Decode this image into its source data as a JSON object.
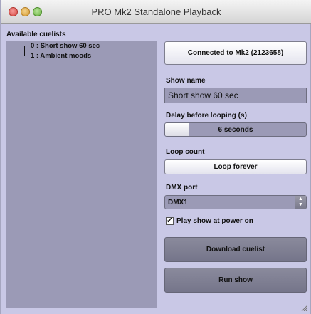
{
  "window": {
    "title": "PRO Mk2 Standalone Playback"
  },
  "cuelists": {
    "label": "Available cuelists",
    "items": [
      {
        "label": "0 : Short show 60 sec"
      },
      {
        "label": "1 : Ambient moods"
      }
    ]
  },
  "connection": {
    "button_label": "Connected to Mk2 (2123658)"
  },
  "show_name": {
    "label": "Show name",
    "value": "Short show 60 sec"
  },
  "delay": {
    "label": "Delay before looping (s)",
    "value_text": "6 seconds"
  },
  "loop_count": {
    "label": "Loop count",
    "button_label": "Loop forever"
  },
  "dmx_port": {
    "label": "DMX port",
    "selected": "DMX1"
  },
  "play_on_power": {
    "label": "Play show at power on",
    "checked": true
  },
  "actions": {
    "download_label": "Download cuelist",
    "run_label": "Run show"
  }
}
